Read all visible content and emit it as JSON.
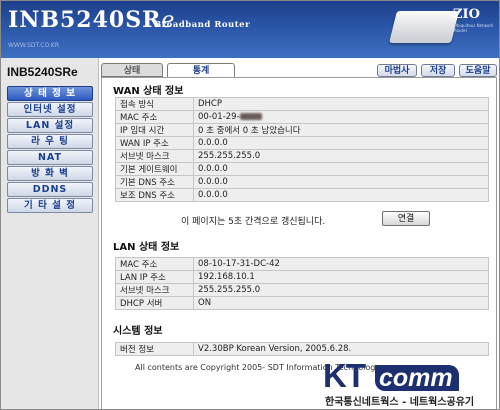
{
  "header": {
    "logo_main": "INB5240SR",
    "logo_e": "e",
    "subtitle": "Broadband Router",
    "url": "WWW.SDT.CO.KR",
    "brand": "ZIO",
    "brand_sub": "Ubiquitous Network Router"
  },
  "sidebar": {
    "model": "INB5240SRe",
    "items": [
      {
        "label": "상 태 정 보"
      },
      {
        "label": "인터넷 설정"
      },
      {
        "label": "LAN 설정"
      },
      {
        "label": "라 우 팅"
      },
      {
        "label": "NAT"
      },
      {
        "label": "방 화 벽"
      },
      {
        "label": "DDNS"
      },
      {
        "label": "기 타 설 정"
      }
    ]
  },
  "tabs": [
    {
      "label": "상태"
    },
    {
      "label": "통계"
    }
  ],
  "top_buttons": [
    {
      "label": "마법사"
    },
    {
      "label": "저장"
    },
    {
      "label": "도움말"
    }
  ],
  "wan": {
    "title": "WAN 상태 정보",
    "rows": [
      {
        "label": "접속 방식",
        "value": "DHCP"
      },
      {
        "label": "MAC 주소",
        "value": "00-01-29-"
      },
      {
        "label": "IP 임대 시간",
        "value": "0  초    중에서  0 초 남았습니다"
      },
      {
        "label": "WAN IP 주소",
        "value": "0.0.0.0"
      },
      {
        "label": "서브넷 마스크",
        "value": "255.255.255.0"
      },
      {
        "label": "기본 게이트웨이",
        "value": "0.0.0.0"
      },
      {
        "label": "기본 DNS 주소",
        "value": "0.0.0.0"
      },
      {
        "label": "보조 DNS 주소",
        "value": "0.0.0.0"
      }
    ],
    "refresh_text": "이 페이지는 5초 간격으로 갱신됩니다.",
    "connect_label": "연결"
  },
  "lan": {
    "title": "LAN 상태 정보",
    "rows": [
      {
        "label": "MAC 주소",
        "value": "08-10-17-31-DC-42"
      },
      {
        "label": "LAN IP 주소",
        "value": "192.168.10.1"
      },
      {
        "label": "서브넷 마스크",
        "value": "255.255.255.0"
      },
      {
        "label": "DHCP 서버",
        "value": "ON"
      }
    ]
  },
  "system": {
    "title": "시스템 정보",
    "rows": [
      {
        "label": "버전 정보",
        "value": "V2.30BP Korean Version, 2005.6.28."
      }
    ]
  },
  "footer": {
    "text": "All contents are Copyright 2005- SDT Information Technology"
  },
  "watermark": {
    "kt": "KT",
    "comm": "comm",
    "caption": "한국통신네트웍스 - 네트웍스공유기"
  }
}
